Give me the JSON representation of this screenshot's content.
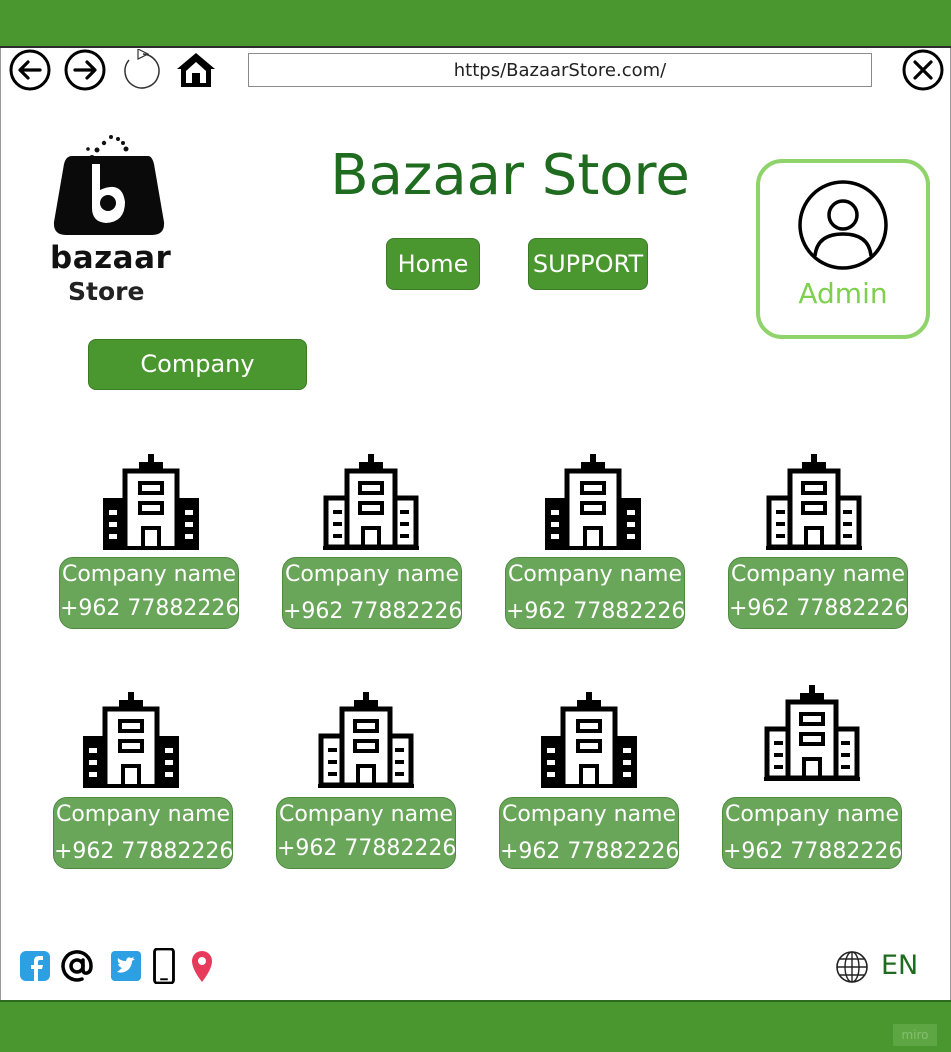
{
  "browser": {
    "url": "https/BazaarStore.com/",
    "icons": [
      "back-arrow-icon",
      "forward-arrow-icon",
      "reload-icon",
      "home-icon",
      "close-icon"
    ]
  },
  "logo": {
    "word1": "bazaar",
    "word2": "Store"
  },
  "header": {
    "title": "Bazaar Store"
  },
  "nav": {
    "home_label": "Home",
    "support_label": "SUPPORT"
  },
  "admin": {
    "label": "Admin"
  },
  "section": {
    "company_label": "Company"
  },
  "companies": [
    {
      "name": "Company name",
      "phone": "+962 77882226",
      "style": "filled"
    },
    {
      "name": "Company name",
      "phone": "+962 77882226",
      "style": "outline"
    },
    {
      "name": "Company name",
      "phone": "+962 77882226",
      "style": "filled"
    },
    {
      "name": "Company name",
      "phone": "+962 77882226",
      "style": "outline"
    },
    {
      "name": "Company name",
      "phone": "+962 77882226",
      "style": "filled"
    },
    {
      "name": "Company name",
      "phone": "+962 77882226",
      "style": "outline"
    },
    {
      "name": "Company name",
      "phone": "+962 77882226",
      "style": "filled"
    },
    {
      "name": "Company name",
      "phone": "+962 77882226",
      "style": "outline"
    }
  ],
  "footer": {
    "social_icons": [
      "facebook-icon",
      "email-at-icon",
      "twitter-icon",
      "phone-icon",
      "location-pin-icon"
    ],
    "language": "EN"
  },
  "colors": {
    "brand_green": "#4a962f",
    "card_green": "#6aa65a",
    "title_green": "#1f6b1f",
    "admin_green": "#8fd36b"
  }
}
